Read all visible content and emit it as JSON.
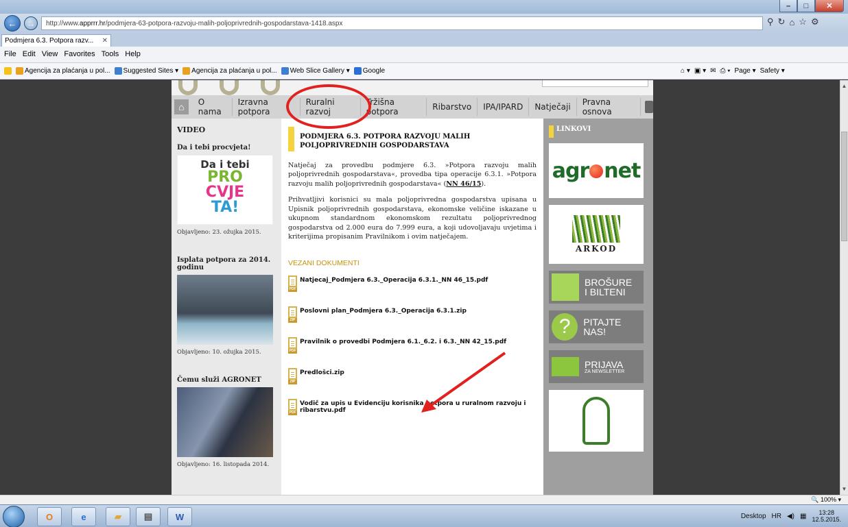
{
  "browser": {
    "url_prefix": "http://www.",
    "url_host": "apprrr.hr",
    "url_path": "/podmjera-63-potpora-razvoju-malih-poljoprivrednih-gospodarstava-1418.aspx",
    "tab_title": "Podmjera 6.3. Potpora razv...",
    "menu": [
      "File",
      "Edit",
      "View",
      "Favorites",
      "Tools",
      "Help"
    ],
    "favorites": [
      "Agencija za plaćanja u pol...",
      "Suggested Sites ▾",
      "Agencija za plaćanja u pol...",
      "Web Slice Gallery ▾",
      "Google"
    ],
    "command_bar": [
      "Page ▾",
      "Safety ▾"
    ],
    "zoom": "100%"
  },
  "site": {
    "nav": [
      "O nama",
      "Izravna potpora",
      "Ruralni razvoj",
      "Tržišna potpora",
      "Ribarstvo",
      "IPA/IPARD",
      "Natječaji",
      "Pravna osnova"
    ],
    "left": {
      "heading": "VIDEO",
      "videos": [
        {
          "title": "Da i tebi procvjeta!",
          "date": "Objavljeno: 23. ožujka 2015.",
          "thumb_text": [
            "Da i tebi",
            "PRO",
            "CVJE",
            "TA!"
          ]
        },
        {
          "title": "Isplata potpora za 2014. godinu",
          "date": "Objavljeno: 10. ožujka 2015."
        },
        {
          "title": "Čemu služi AGRONET",
          "date": "Objavljeno: 16. listopada 2014."
        }
      ]
    },
    "article": {
      "title": "PODMJERA 6.3. POTPORA RAZVOJU MALIH POLJOPRIVREDNIH GOSPODARSTAVA",
      "p1": "Natječaj za provedbu podmjere 6.3. »Potpora razvoju malih poljoprivrednih gospodarstava«, provedba tipa operacije 6.3.1. »Potpora razvoju malih poljoprivrednih gospodarstava« (",
      "p1_link": "NN 46/15",
      "p1_end": ").",
      "p2": "Prihvatljivi korisnici su mala poljoprivredna gospodarstva upisana u Upisnik poljoprivrednih gospodarstava, ekonomske veličine iskazane u ukupnom standardnom ekonomskom rezultatu poljoprivrednog gospodarstva od 2.000 eura do 7.999 eura, a koji udovoljavaju uvjetima i kriterijima propisanim Pravilnikom i ovim natječajem.",
      "docs_heading": "VEZANI DOKUMENTI",
      "docs": [
        {
          "name": "Natjecaj_Podmjera 6.3._Operacija 6.3.1._NN 46_15.pdf",
          "type": "PDF"
        },
        {
          "name": "Poslovni plan_Podmjera 6.3._Operacija 6.3.1.zip",
          "type": "ZIP"
        },
        {
          "name": "Pravilnik o provedbi Podmjera 6.1._6.2. i 6.3._NN 42_15.pdf",
          "type": "PDF"
        },
        {
          "name": "Predlošci.zip",
          "type": "ZIP"
        },
        {
          "name": "Vodič za upis u Evidenciju korisnika potpora u ruralnom razvoju i ribarstvu.pdf",
          "type": "PDF"
        }
      ]
    },
    "right": {
      "heading": "LINKOVI",
      "agronet": "agr",
      "agronet_end": "net",
      "arkod": "ARKOD",
      "brosure": [
        "BROŠURE",
        "I BILTENI"
      ],
      "pitajte": "PITAJTE NAS!",
      "prijava": "PRIJAVA",
      "prijava_sub": "ZA NEWSLETTER"
    }
  },
  "taskbar": {
    "desktop": "Desktop",
    "lang": "HR",
    "time": "13:28",
    "date": "12.5.2015."
  },
  "colors": {
    "annotation": "#e12020",
    "accent_yellow": "#f5d33e",
    "docs_heading": "#c8930c"
  }
}
